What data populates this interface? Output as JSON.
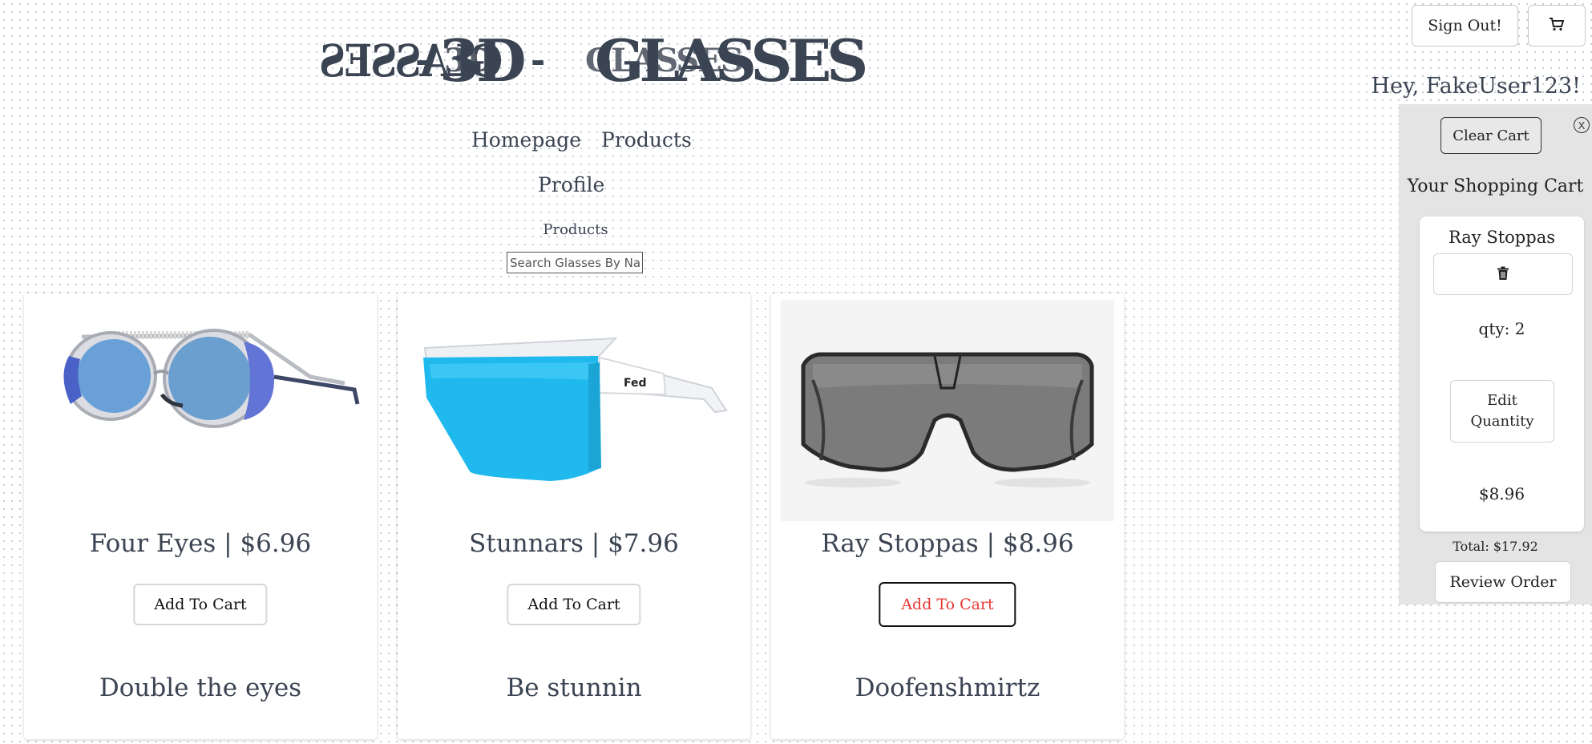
{
  "logo": {
    "mirror_text": "GLASSES",
    "dash": "-",
    "main_3d": "3D",
    "ghost_3d": "3D",
    "main_glasses": "GLASSES",
    "ghost_glasses": "GLASSES"
  },
  "header": {
    "sign_out_label": "Sign Out!",
    "greeting": "Hey, FakeUser123!"
  },
  "nav": {
    "homepage": "Homepage",
    "products": "Products",
    "profile": "Profile"
  },
  "products_section": {
    "label": "Products",
    "search_placeholder": "Search Glasses By Name"
  },
  "products": [
    {
      "title": "Four Eyes | $6.96",
      "add_label": "Add To Cart",
      "description": "Double the eyes",
      "icon": "round-steampunk-sunglasses"
    },
    {
      "title": "Stunnars | $7.96",
      "add_label": "Add To Cart",
      "description": "Be stunnin",
      "icon": "blue-shield-sunglasses"
    },
    {
      "title": "Ray Stoppas | $8.96",
      "add_label": "Add To Cart",
      "description": "Doofenshmirtz",
      "icon": "gray-shield-sunglasses"
    }
  ],
  "cart": {
    "clear_label": "Clear Cart",
    "close_label": "X",
    "title": "Your Shopping Cart",
    "item": {
      "name": "Ray Stoppas",
      "qty": "qty: 2",
      "edit_label": "Edit Quantity",
      "price": "$8.96"
    },
    "total": "Total: $17.92",
    "review_label": "Review Order"
  },
  "colors": {
    "text": "#3b4452",
    "active_add": "#e53935",
    "cart_bg": "#e4e4e4"
  }
}
